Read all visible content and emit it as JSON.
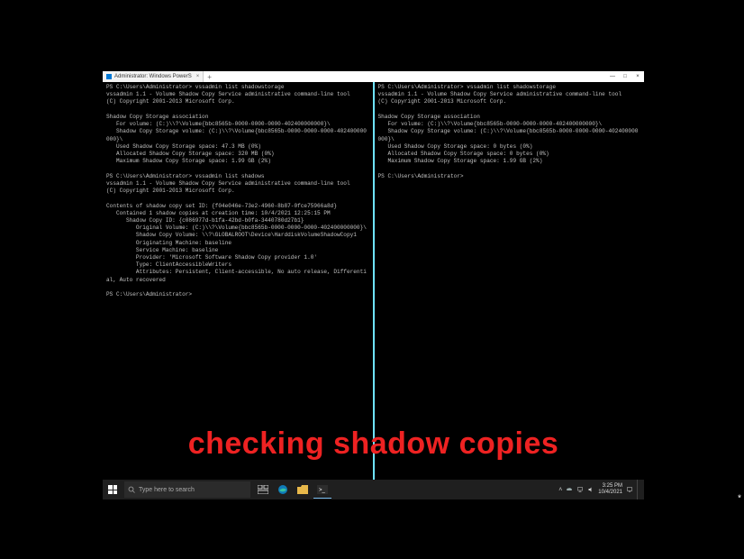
{
  "window": {
    "tab_title": "Administrator: Windows PowerS",
    "tab_close": "×",
    "tab_plus": "+",
    "min": "—",
    "max": "□",
    "close": "×"
  },
  "left_pane": {
    "text": "PS C:\\Users\\Administrator> vssadmin list shadowstorage\nvssadmin 1.1 - Volume Shadow Copy Service administrative command-line tool\n(C) Copyright 2001-2013 Microsoft Corp.\n\nShadow Copy Storage association\n   For volume: (C:)\\\\?\\Volume{bbc8565b-0000-0000-0000-402400000000}\\\n   Shadow Copy Storage volume: (C:)\\\\?\\Volume{bbc8565b-0000-0000-0000-402400000000}\\\n   Used Shadow Copy Storage space: 47.3 MB (0%)\n   Allocated Shadow Copy Storage space: 320 MB (0%)\n   Maximum Shadow Copy Storage space: 1.99 GB (2%)\n\nPS C:\\Users\\Administrator> vssadmin list shadows\nvssadmin 1.1 - Volume Shadow Copy Service administrative command-line tool\n(C) Copyright 2001-2013 Microsoft Corp.\n\nContents of shadow copy set ID: {f04e046e-73e2-4960-8b87-0fce75966a8d}\n   Contained 1 shadow copies at creation time: 10/4/2021 12:25:15 PM\n      Shadow Copy ID: {c086977d-b1fa-42bd-b0fa-3440780d27b1}\n         Original Volume: (C:)\\\\?\\Volume{bbc8565b-0000-0000-0000-402400000000}\\\n         Shadow Copy Volume: \\\\?\\GLOBALROOT\\Device\\HarddiskVolumeShadowCopy1\n         Originating Machine: baseline\n         Service Machine: baseline\n         Provider: 'Microsoft Software Shadow Copy provider 1.0'\n         Type: ClientAccessibleWriters\n         Attributes: Persistent, Client-accessible, No auto release, Differential, Auto recovered\n\nPS C:\\Users\\Administrator>"
  },
  "right_pane": {
    "text": "PS C:\\Users\\Administrator> vssadmin list shadowstorage\nvssadmin 1.1 - Volume Shadow Copy Service administrative command-line tool\n(C) Copyright 2001-2013 Microsoft Corp.\n\nShadow Copy Storage association\n   For volume: (C:)\\\\?\\Volume{bbc8565b-0000-0000-0000-402400000000}\\\n   Shadow Copy Storage volume: (C:)\\\\?\\Volume{bbc8565b-0000-0000-0000-402400000000}\\\n   Used Shadow Copy Storage space: 0 bytes (0%)\n   Allocated Shadow Copy Storage space: 0 bytes (0%)\n   Maximum Shadow Copy Storage space: 1.99 GB (2%)\n\nPS C:\\Users\\Administrator>"
  },
  "caption": "checking shadow copies",
  "taskbar": {
    "search_placeholder": "Type here to search",
    "time": "3:25 PM",
    "date": "10/4/2021"
  },
  "stray": "*"
}
